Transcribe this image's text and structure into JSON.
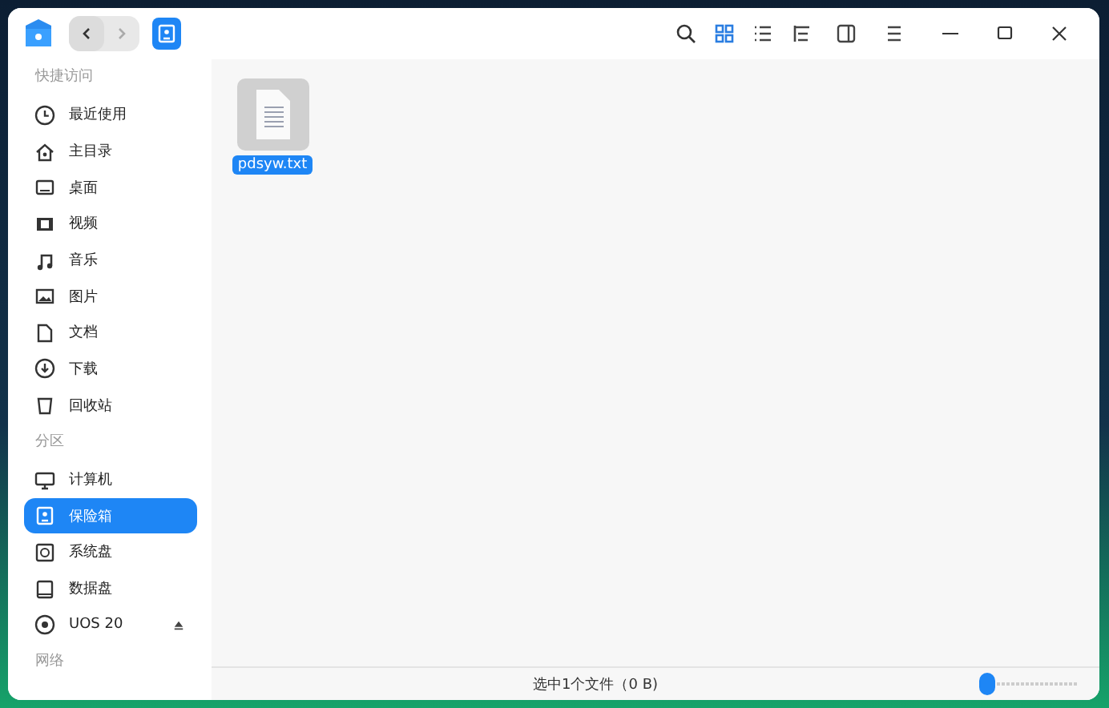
{
  "titlebar": {
    "back": {
      "disabled": false
    },
    "forward": {
      "disabled": true
    },
    "view_modes": [
      {
        "kind": "icon",
        "selected": true
      },
      {
        "kind": "list",
        "selected": false
      }
    ]
  },
  "sidebar": [
    {
      "heading": "快捷访问",
      "items": [
        {
          "label": "最近使用",
          "kind": "clock",
          "selected": false
        },
        {
          "label": "主目录",
          "kind": "home",
          "selected": false
        },
        {
          "label": "桌面",
          "kind": "desktop",
          "selected": false
        },
        {
          "label": "视频",
          "kind": "video",
          "selected": false
        },
        {
          "label": "音乐",
          "kind": "music",
          "selected": false
        },
        {
          "label": "图片",
          "kind": "picture",
          "selected": false
        },
        {
          "label": "文档",
          "kind": "document",
          "selected": false
        },
        {
          "label": "下载",
          "kind": "download",
          "selected": false
        },
        {
          "label": "回收站",
          "kind": "trash",
          "selected": false
        }
      ]
    },
    {
      "heading": "分区",
      "items": [
        {
          "label": "计算机",
          "kind": "computer",
          "selected": false
        },
        {
          "label": "保险箱",
          "kind": "vault",
          "selected": true
        },
        {
          "label": "系统盘",
          "kind": "sysdisk",
          "selected": false
        },
        {
          "label": "数据盘",
          "kind": "disk",
          "selected": false
        },
        {
          "label": "UOS 20",
          "kind": "disc",
          "selected": false,
          "ejectable": true
        }
      ]
    },
    {
      "heading": "网络"
    }
  ],
  "files": [
    {
      "name": "pdsyw.txt",
      "kind": "text",
      "selected": true
    }
  ],
  "status_bar": {
    "text": "选中1个文件（0 B)",
    "zoom": {
      "level": 0
    }
  }
}
